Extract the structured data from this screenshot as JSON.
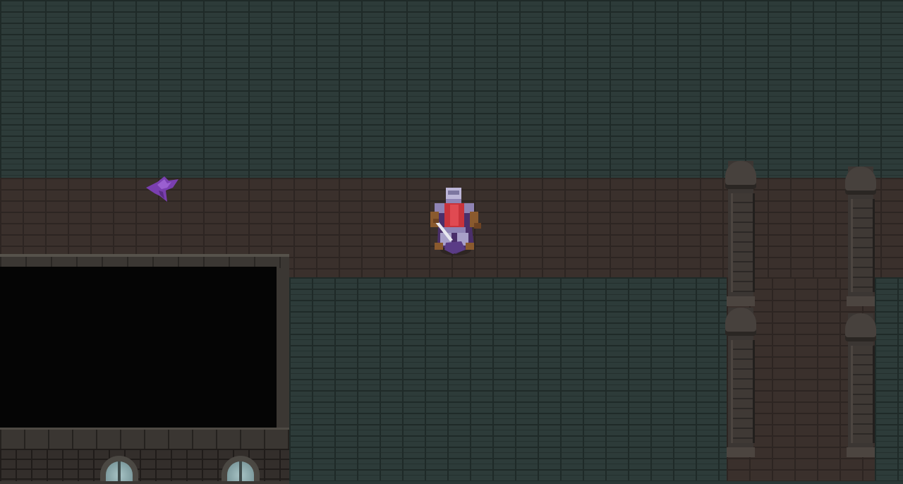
{
  "scene": {
    "type": "top-down dungeon",
    "palette": {
      "wall": "#2d3b39",
      "corridor": "#3a302c",
      "void": "#050505",
      "stone": "#3b3633"
    }
  },
  "player": {
    "sprite": "armored-knight-icon",
    "accent": "#c8333b",
    "armor": "#8f84b4"
  },
  "enemies": [
    {
      "sprite": "purple-bat-icon",
      "color": "#7a3fb0"
    }
  ],
  "structures": {
    "pillars": [
      "pillar",
      "pillar",
      "pillar",
      "pillar"
    ],
    "windows": [
      "arched-window",
      "arched-window"
    ]
  }
}
